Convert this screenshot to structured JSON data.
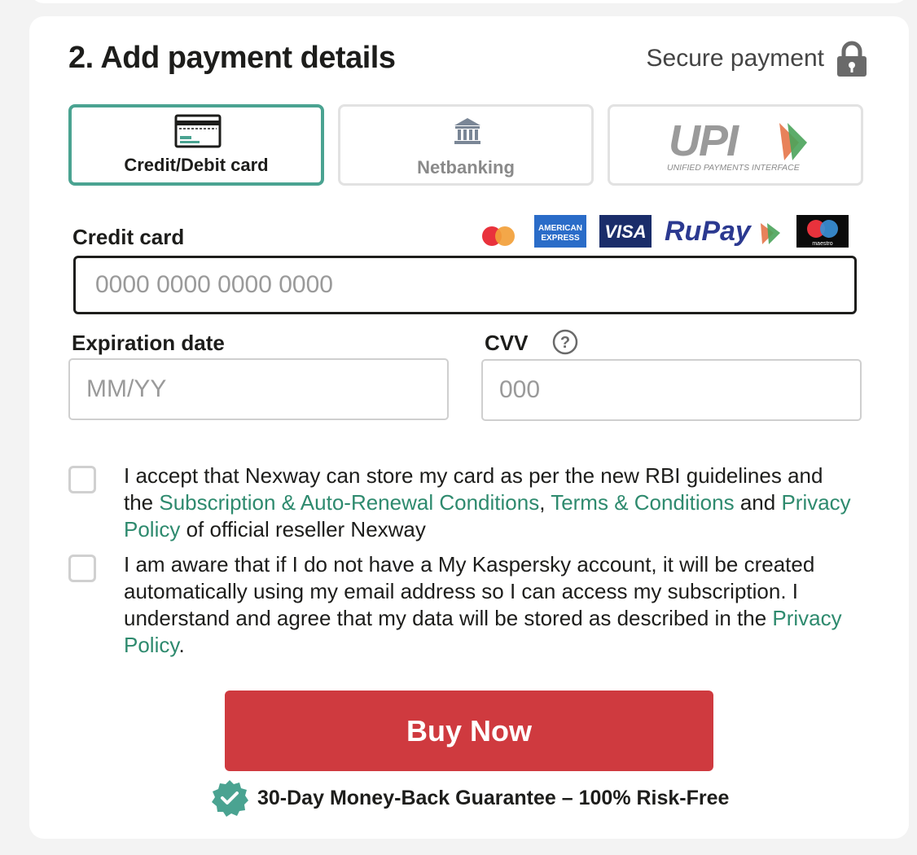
{
  "section": {
    "title": "2. Add payment details",
    "secure_label": "Secure payment"
  },
  "payment_methods": [
    {
      "label": "Credit/Debit card",
      "icon": "credit-card-icon",
      "selected": true
    },
    {
      "label": "Netbanking",
      "icon": "bank-icon",
      "selected": false
    },
    {
      "label": "UPI",
      "subtitle": "UNIFIED PAYMENTS INTERFACE",
      "icon": "upi-logo",
      "selected": false
    }
  ],
  "credit_card": {
    "label": "Credit card",
    "placeholder": "0000 0000 0000 0000",
    "value": "",
    "brands": [
      {
        "name": "mastercard",
        "text": ""
      },
      {
        "name": "american-express",
        "text": "AMERICAN EXPRESS"
      },
      {
        "name": "visa",
        "text": "VISA"
      },
      {
        "name": "rupay",
        "text": "RuPay"
      },
      {
        "name": "maestro",
        "text": "maestro"
      }
    ]
  },
  "expiration": {
    "label": "Expiration date",
    "placeholder": "MM/YY",
    "value": ""
  },
  "cvv": {
    "label": "CVV",
    "placeholder": "000",
    "value": "",
    "help_glyph": "?"
  },
  "consents": [
    {
      "checked": false,
      "text_1": "I accept that Nexway can store my card as per the new RBI guidelines and the ",
      "link_1": "Subscription & Auto-Renewal Conditions",
      "text_2": ", ",
      "link_2": "Terms & Conditions",
      "text_3": " and ",
      "link_3": "Privacy Policy",
      "text_4": " of official reseller Nexway"
    },
    {
      "checked": false,
      "text_1": "I am aware that if I do not have a My Kaspersky account, it will be created automatically using my email address so I can access my subscription. I understand and agree that my data will be stored as described in the ",
      "link_1": "Privacy Policy",
      "text_2": "."
    }
  ],
  "buy_button": {
    "label": "Buy Now"
  },
  "guarantee": {
    "text": "30-Day Money-Back Guarantee – 100% Risk-Free"
  },
  "colors": {
    "accent": "#4aa391",
    "link": "#2e8a6e",
    "buy_button": "#cf3a3f",
    "text": "#1d1d1b"
  }
}
